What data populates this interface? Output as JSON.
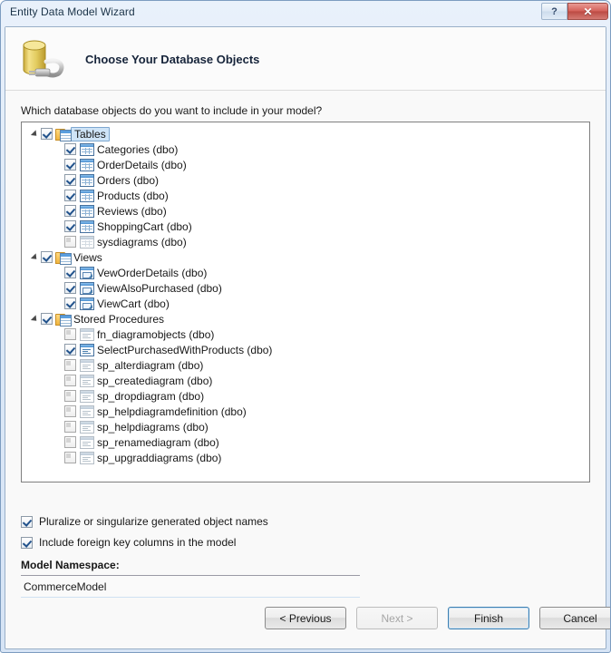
{
  "window": {
    "title": "Entity Data Model Wizard",
    "help_button": "?",
    "close_button": "✕"
  },
  "header": {
    "title": "Choose Your Database Objects",
    "icon": "database-plug-icon"
  },
  "prompt": "Which database objects do you want to include in your model?",
  "tree": {
    "groups": [
      {
        "label": "Tables",
        "icon": "tables-folder-icon",
        "checked": true,
        "selected": true,
        "expanded": true,
        "children": [
          {
            "label": "Categories (dbo)",
            "icon": "table-icon",
            "checked": true
          },
          {
            "label": "OrderDetails (dbo)",
            "icon": "table-icon",
            "checked": true
          },
          {
            "label": "Orders (dbo)",
            "icon": "table-icon",
            "checked": true
          },
          {
            "label": "Products (dbo)",
            "icon": "table-icon",
            "checked": true
          },
          {
            "label": "Reviews (dbo)",
            "icon": "table-icon",
            "checked": true
          },
          {
            "label": "ShoppingCart (dbo)",
            "icon": "table-icon",
            "checked": true
          },
          {
            "label": "sysdiagrams (dbo)",
            "icon": "table-icon",
            "checked": false
          }
        ]
      },
      {
        "label": "Views",
        "icon": "views-folder-icon",
        "checked": true,
        "selected": false,
        "expanded": true,
        "children": [
          {
            "label": "VewOrderDetails (dbo)",
            "icon": "view-icon",
            "checked": true
          },
          {
            "label": "ViewAlsoPurchased (dbo)",
            "icon": "view-icon",
            "checked": true
          },
          {
            "label": "ViewCart (dbo)",
            "icon": "view-icon",
            "checked": true
          }
        ]
      },
      {
        "label": "Stored Procedures",
        "icon": "procedures-folder-icon",
        "checked": true,
        "selected": false,
        "expanded": true,
        "children": [
          {
            "label": "fn_diagramobjects (dbo)",
            "icon": "procedure-icon",
            "checked": false
          },
          {
            "label": "SelectPurchasedWithProducts (dbo)",
            "icon": "procedure-icon",
            "checked": true
          },
          {
            "label": "sp_alterdiagram (dbo)",
            "icon": "procedure-icon",
            "checked": false
          },
          {
            "label": "sp_creatediagram (dbo)",
            "icon": "procedure-icon",
            "checked": false
          },
          {
            "label": "sp_dropdiagram (dbo)",
            "icon": "procedure-icon",
            "checked": false
          },
          {
            "label": "sp_helpdiagramdefinition (dbo)",
            "icon": "procedure-icon",
            "checked": false
          },
          {
            "label": "sp_helpdiagrams (dbo)",
            "icon": "procedure-icon",
            "checked": false
          },
          {
            "label": "sp_renamediagram (dbo)",
            "icon": "procedure-icon",
            "checked": false
          },
          {
            "label": "sp_upgraddiagrams (dbo)",
            "icon": "procedure-icon",
            "checked": false
          }
        ]
      }
    ]
  },
  "options": {
    "pluralize": {
      "label": "Pluralize or singularize generated object names",
      "checked": true
    },
    "foreign_keys": {
      "label": "Include foreign key columns in the model",
      "checked": true
    }
  },
  "namespace": {
    "label": "Model Namespace:",
    "value": "CommerceModel",
    "placeholder": ""
  },
  "buttons": {
    "previous": "< Previous",
    "next": "Next >",
    "finish": "Finish",
    "cancel": "Cancel"
  },
  "colors": {
    "accent": "#3c7fb1",
    "close_red": "#bc4a43",
    "folder_yellow": "#f0b43d",
    "selection_blue": "#cfe4f7"
  }
}
